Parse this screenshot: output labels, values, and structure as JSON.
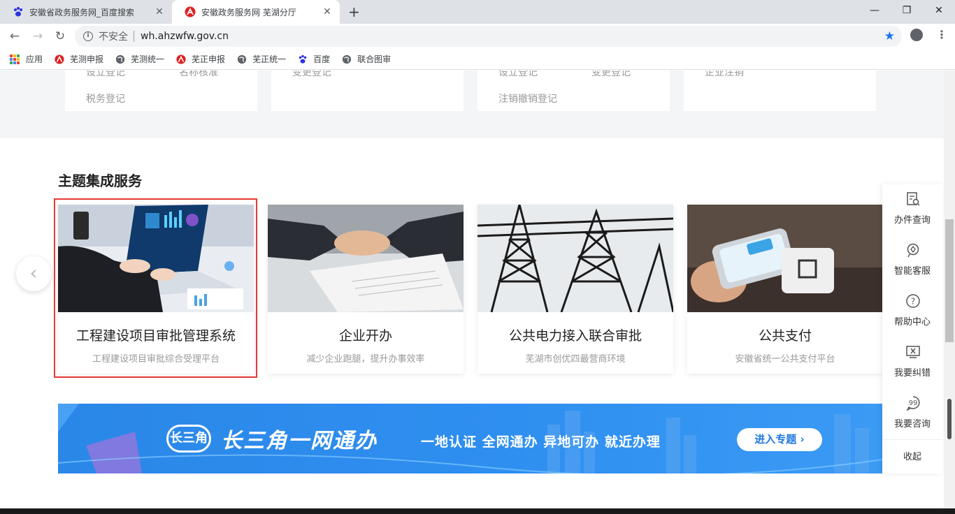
{
  "browser": {
    "tabs": [
      {
        "title": "安徽省政务服务网_百度搜索",
        "active": false
      },
      {
        "title": "安徽政务服务网 芜湖分厅",
        "active": true
      }
    ],
    "new_tab": "+",
    "window_controls": {
      "minimize": "—",
      "restore": "❐",
      "close": "✕"
    },
    "security_label": "不安全",
    "url": "wh.ahzwfw.gov.cn",
    "bookmarks": [
      {
        "label": "应用",
        "icon": "apps-grid-icon"
      },
      {
        "label": "芜测申报",
        "icon": "ah-logo-icon"
      },
      {
        "label": "芜测统一",
        "icon": "globe-icon"
      },
      {
        "label": "芜正申报",
        "icon": "ah-logo-icon"
      },
      {
        "label": "芜正统一",
        "icon": "globe-icon"
      },
      {
        "label": "百度",
        "icon": "baidu-paw-icon"
      },
      {
        "label": "联合图审",
        "icon": "globe-icon"
      }
    ]
  },
  "top_cards": [
    {
      "links": [
        "设立登记",
        "名称核准",
        "税务登记"
      ]
    },
    {
      "links": [
        "变更登记"
      ]
    },
    {
      "links": [
        "设立登记",
        "变更登记",
        "注销撤销登记"
      ]
    },
    {
      "links": [
        "企业注销"
      ]
    }
  ],
  "section": {
    "title": "主题集成服务",
    "cards": [
      {
        "title": "工程建设项目审批管理系统",
        "subtitle": "工程建设项目审批综合受理平台",
        "image": "laptop-business-photo"
      },
      {
        "title": "企业开办",
        "subtitle": "减少企业跑腿，提升办事效率",
        "image": "handshake-photo"
      },
      {
        "title": "公共电力接入联合审批",
        "subtitle": "芜湖市创优四最营商环境",
        "image": "power-tower-photo"
      },
      {
        "title": "公共支付",
        "subtitle": "安徽省统一公共支付平台",
        "image": "mobile-payment-photo"
      }
    ],
    "prev_arrow": "‹"
  },
  "banner": {
    "logo": "长三角",
    "title": "长三角一网通办",
    "slogan": "一地认证  全网通办  异地可办  就近办理",
    "button": "进入专题 ›"
  },
  "sidebar": {
    "items": [
      {
        "label": "办件查询",
        "icon": "search-doc-icon"
      },
      {
        "label": "智能客服",
        "icon": "robot-icon"
      },
      {
        "label": "帮助中心",
        "icon": "help-icon"
      },
      {
        "label": "我要纠错",
        "icon": "error-report-icon"
      },
      {
        "label": "我要咨询",
        "icon": "chat-icon"
      }
    ],
    "collapse": "收起"
  },
  "colors": {
    "accent": "#1f78e0",
    "highlight_border": "#e53935",
    "banner_bg": "#2a87e8"
  }
}
